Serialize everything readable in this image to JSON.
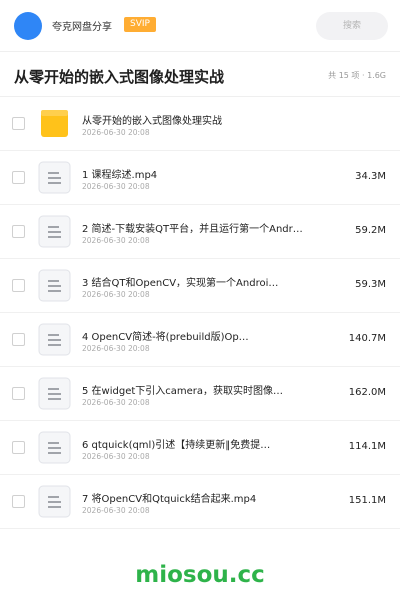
{
  "header": {
    "username": "夸克网盘分享",
    "vip_label": "SVIP",
    "search_placeholder": "搜索"
  },
  "folder": {
    "title": "从零开始的嵌入式图像处理实战",
    "summary": "共 15 项 · 1.6G"
  },
  "files": [
    {
      "name": "从零开始的嵌入式图像处理实战",
      "date": "2026-06-30 20:08",
      "size": "",
      "type": "folder-icon"
    },
    {
      "name": "1 课程综述.mp4",
      "date": "2026-06-30 20:08",
      "size": "34.3M",
      "type": "file-icon"
    },
    {
      "name": "2 简述-下载安装QT平台，并且运行第一个Andr…",
      "date": "2026-06-30 20:08",
      "size": "59.2M",
      "type": "file-icon"
    },
    {
      "name": "3 结合QT和OpenCV，实现第一个Androi…",
      "date": "2026-06-30 20:08",
      "size": "59.3M",
      "type": "file-icon"
    },
    {
      "name": "4 OpenCV简述-将(prebuild版)Op…",
      "date": "2026-06-30 20:08",
      "size": "140.7M",
      "type": "file-icon"
    },
    {
      "name": "5 在widget下引入camera，获取实时图像…",
      "date": "2026-06-30 20:08",
      "size": "162.0M",
      "type": "file-icon"
    },
    {
      "name": "6 qtquick(qml)引述【持续更新‖免费提…",
      "date": "2026-06-30 20:08",
      "size": "114.1M",
      "type": "file-icon"
    },
    {
      "name": "7 将OpenCV和Qtquick结合起来.mp4",
      "date": "2026-06-30 20:08",
      "size": "151.1M",
      "type": "file-icon"
    }
  ],
  "watermark": "miosou.cc",
  "colors": {
    "accent": "#2f86f6",
    "vip": "#ffad33",
    "folder": "#ffc21a",
    "watermark": "#2eb34a"
  }
}
